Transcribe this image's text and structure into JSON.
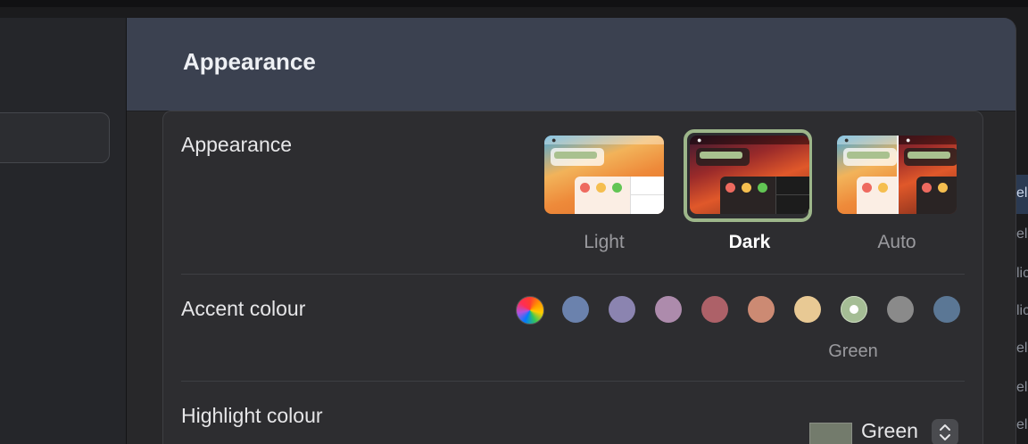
{
  "window": {
    "title": "Appearance"
  },
  "appearance": {
    "label": "Appearance",
    "options": [
      {
        "label": "Light",
        "selected": false
      },
      {
        "label": "Dark",
        "selected": true
      },
      {
        "label": "Auto",
        "selected": false
      }
    ]
  },
  "accent": {
    "label": "Accent colour",
    "selected_name": "Green",
    "swatches": [
      {
        "name": "multicolour",
        "color": "conic"
      },
      {
        "name": "blue",
        "color": "#6b82ad"
      },
      {
        "name": "purple",
        "color": "#8b84b0"
      },
      {
        "name": "pink",
        "color": "#ad8bac"
      },
      {
        "name": "red",
        "color": "#ad6168"
      },
      {
        "name": "orange",
        "color": "#cc8a73"
      },
      {
        "name": "yellow",
        "color": "#e8c994"
      },
      {
        "name": "green",
        "color": "#a5bd95",
        "selected": true
      },
      {
        "name": "graphite",
        "color": "#8a8a8a"
      },
      {
        "name": "steel",
        "color": "#5b7795"
      }
    ]
  },
  "highlight": {
    "label": "Highlight colour",
    "value": "Green",
    "color": "#737b6c"
  },
  "edge_fragments": [
    "el",
    "el",
    "lic",
    "lic",
    "el",
    "el",
    "el"
  ]
}
